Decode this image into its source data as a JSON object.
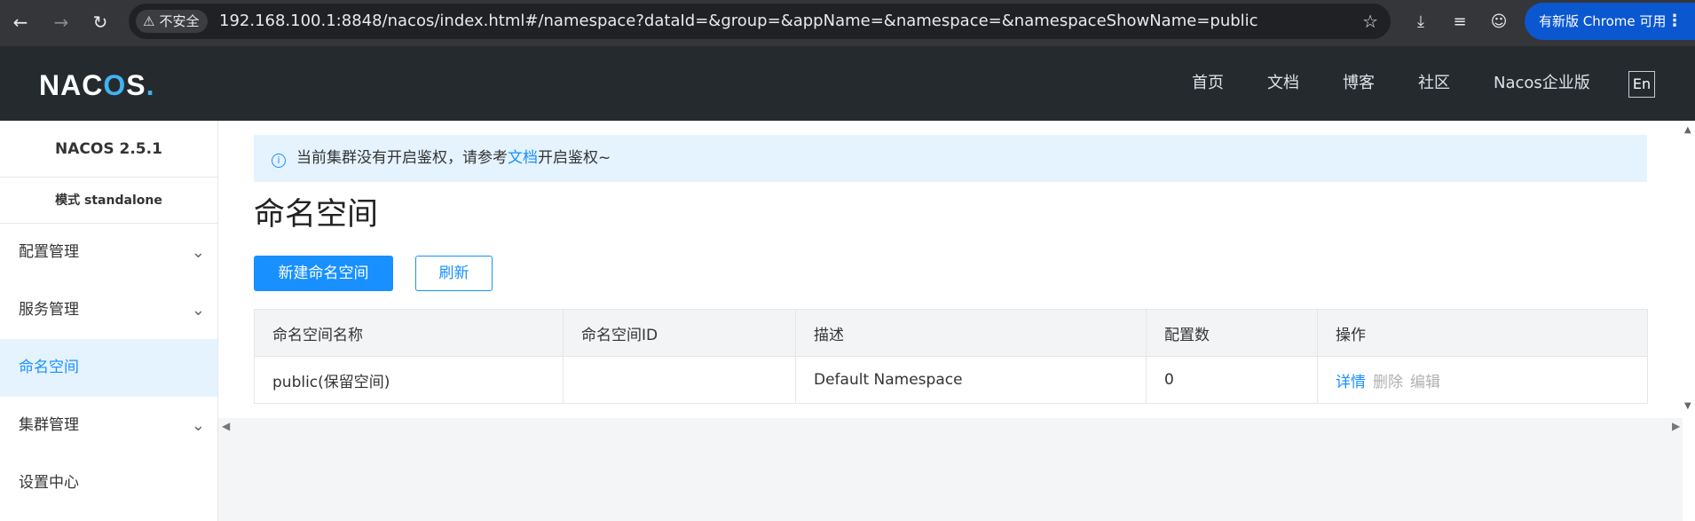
{
  "browser": {
    "security_label": "不安全",
    "url": "192.168.100.1:8848/nacos/index.html#/namespace?dataId=&group=&appName=&namespace=&namespaceShowName=public",
    "update_label": "有新版 Chrome 可用"
  },
  "header": {
    "logo": "NACOS.",
    "nav": [
      "首页",
      "文档",
      "博客",
      "社区",
      "Nacos企业版"
    ],
    "lang": "En"
  },
  "sidebar": {
    "version": "NACOS 2.5.1",
    "mode": "模式 standalone",
    "items": [
      {
        "label": "配置管理",
        "expandable": true
      },
      {
        "label": "服务管理",
        "expandable": true
      },
      {
        "label": "命名空间",
        "active": true
      },
      {
        "label": "集群管理",
        "expandable": true
      },
      {
        "label": "设置中心"
      }
    ]
  },
  "notice": {
    "prefix": "当前集群没有开启鉴权，请参考",
    "link": "文档",
    "suffix": "开启鉴权~"
  },
  "page": {
    "title": "命名空间",
    "create_button": "新建命名空间",
    "refresh_button": "刷新"
  },
  "table": {
    "columns": [
      "命名空间名称",
      "命名空间ID",
      "描述",
      "配置数",
      "操作"
    ],
    "rows": [
      {
        "name": "public(保留空间)",
        "id": "",
        "description": "Default Namespace",
        "count": "0",
        "actions": {
          "detail": "详情",
          "delete": "删除",
          "edit": "编辑"
        }
      }
    ]
  },
  "colors": {
    "accent": "#1890ff",
    "header_bg": "#252a2f",
    "notice_bg": "#e5f3ff"
  }
}
